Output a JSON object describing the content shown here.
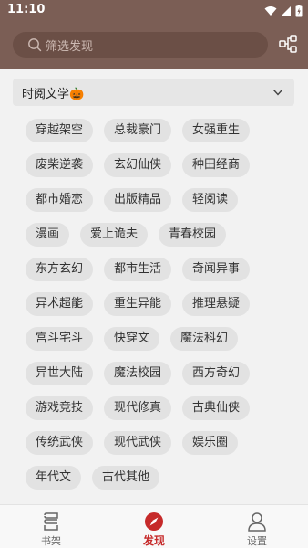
{
  "status_bar": {
    "time": "11:10"
  },
  "search": {
    "placeholder": "筛选发现"
  },
  "dropdown": {
    "selected": "时阅文学🎃"
  },
  "tags": [
    "穿越架空",
    "总裁豪门",
    "女强重生",
    "废柴逆袭",
    "玄幻仙侠",
    "种田经商",
    "都市婚恋",
    "出版精品",
    "轻阅读",
    "漫画",
    "爱上诡夫",
    "青春校园",
    "东方玄幻",
    "都市生活",
    "奇闻异事",
    "异术超能",
    "重生异能",
    "推理悬疑",
    "宫斗宅斗",
    "快穿文",
    "魔法科幻",
    "异世大陆",
    "魔法校园",
    "西方奇幻",
    "游戏竞技",
    "现代修真",
    "古典仙侠",
    "传统武侠",
    "现代武侠",
    "娱乐圈",
    "年代文",
    "古代其他"
  ],
  "bottom_nav": {
    "bookshelf": "书架",
    "discover": "发现",
    "settings": "设置"
  },
  "colors": {
    "header": "#7b5e55",
    "accent": "#c62a2a"
  }
}
